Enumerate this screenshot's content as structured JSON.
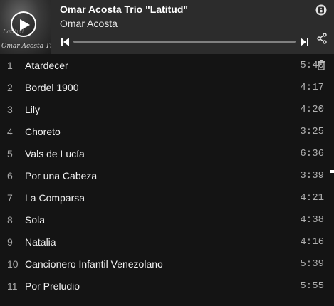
{
  "player": {
    "album_title": "Omar Acosta Trío \"Latitud\"",
    "artist": "Omar Acosta",
    "cover_text_line1": "Latitud",
    "cover_text_line2": "Omar Acosta Trío",
    "progress_fraction": 0.0,
    "icons": {
      "play": "play-icon",
      "previous": "skip-previous-icon",
      "next": "skip-next-icon",
      "device": "speaker-device-icon",
      "share": "share-icon",
      "trash": "trash-icon"
    }
  },
  "tracks": [
    {
      "number": "1",
      "name": "Atardecer",
      "duration": "5:40"
    },
    {
      "number": "2",
      "name": "Bordel 1900",
      "duration": "4:17"
    },
    {
      "number": "3",
      "name": "Lily",
      "duration": "4:20"
    },
    {
      "number": "4",
      "name": "Choreto",
      "duration": "3:25"
    },
    {
      "number": "5",
      "name": "Vals de Lucía",
      "duration": "6:36"
    },
    {
      "number": "6",
      "name": "Por una Cabeza",
      "duration": "3:39"
    },
    {
      "number": "7",
      "name": "La Comparsa",
      "duration": "4:21"
    },
    {
      "number": "8",
      "name": "Sola",
      "duration": "4:38"
    },
    {
      "number": "9",
      "name": "Natalia",
      "duration": "4:16"
    },
    {
      "number": "10",
      "name": "Cancionero Infantil Venezolano",
      "duration": "5:39"
    },
    {
      "number": "11",
      "name": "Por Preludio",
      "duration": "5:55"
    }
  ],
  "colors": {
    "background": "#141414",
    "player_bar": "#2c2c2c",
    "text": "#ffffff",
    "muted": "#a9a9a9"
  }
}
